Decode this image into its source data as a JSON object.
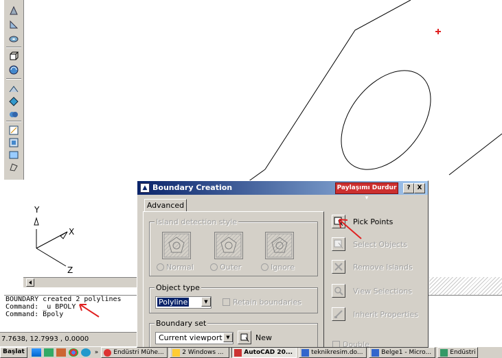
{
  "dialog": {
    "title": "Boundary Creation",
    "share_label": "Paylaşımı Durdur ▾",
    "help_label": "?",
    "close_label": "X",
    "tab_label": "Advanced",
    "island_group_title": "Island detection style",
    "island_options": [
      "Normal",
      "Outer",
      "Ignore"
    ],
    "object_type_title": "Object type",
    "object_type_value": "Polyline",
    "retain_label": "Retain boundaries",
    "boundary_set_title": "Boundary set",
    "boundary_set_value": "Current viewport",
    "new_label": "New",
    "double_label": "Double",
    "actions": [
      {
        "label": "Pick Points",
        "icon": "pick-points-icon",
        "enabled": true
      },
      {
        "label": "Select Objects",
        "icon": "select-objects-icon",
        "enabled": false
      },
      {
        "label": "Remove Islands",
        "icon": "remove-islands-icon",
        "enabled": false
      },
      {
        "label": "View Selections",
        "icon": "view-selections-icon",
        "enabled": false
      },
      {
        "label": "Inherit Properties",
        "icon": "inherit-properties-icon",
        "enabled": false
      }
    ]
  },
  "ucs": {
    "y": "Y",
    "x": "X",
    "z": "Z"
  },
  "command": {
    "lines": [
      "BOUNDARY created 2 polylines",
      "Command: _u BPOLY",
      "Command: Bpoly"
    ]
  },
  "status": {
    "coords": "7.7638, 12.7993 , 0.0000"
  },
  "taskbar": {
    "start_label": "Başlat",
    "overflow": "»",
    "items": [
      {
        "label": "Endüstri Mühe...",
        "active": false
      },
      {
        "label": "2 Windows ...",
        "active": false
      },
      {
        "label": "AutoCAD 20...",
        "active": true
      },
      {
        "label": "teknikresim.do...",
        "active": false
      },
      {
        "label": "Belge1 - Micro...",
        "active": false
      },
      {
        "label": "Endüstri",
        "active": false
      }
    ]
  },
  "colors": {
    "accent_red": "#e02020",
    "title_blue": "#0a246a"
  }
}
